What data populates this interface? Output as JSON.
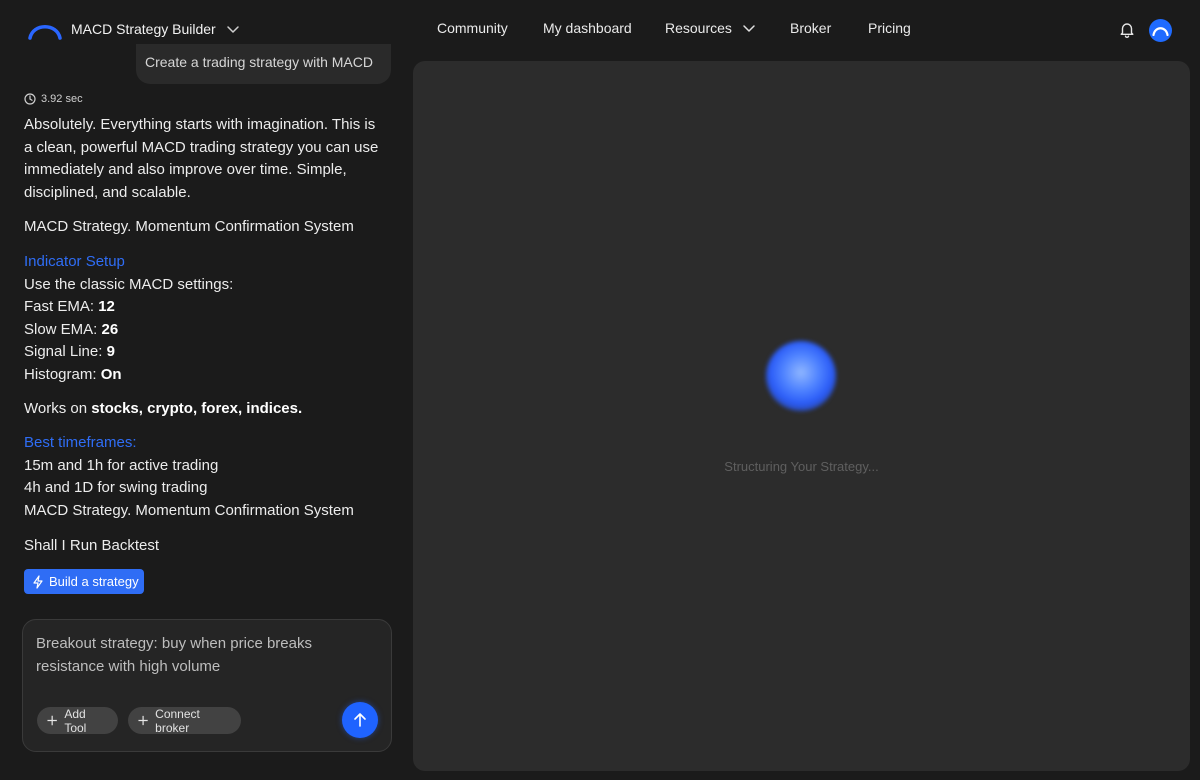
{
  "app": {
    "title": "MACD Strategy Builder"
  },
  "nav": {
    "items": [
      {
        "label": "Community"
      },
      {
        "label": "My dashboard"
      },
      {
        "label": "Resources"
      },
      {
        "label": "Broker"
      },
      {
        "label": "Pricing"
      }
    ]
  },
  "chat": {
    "user_message": "Create a trading strategy with MACD",
    "response_time": "3.92 sec",
    "intro": "Absolutely. Everything starts with imagination. This is a clean, powerful MACD trading strategy you can use immediately and also improve over time. Simple, disciplined, and scalable.",
    "strategy_name": "MACD Strategy. Momentum Confirmation System",
    "indicator_heading": "Indicator Setup",
    "indicator_intro": "Use the classic MACD settings:",
    "settings": [
      {
        "label": "Fast EMA: ",
        "value": "12"
      },
      {
        "label": "Slow EMA: ",
        "value": "26"
      },
      {
        "label": "Signal Line: ",
        "value": "9"
      },
      {
        "label": "Histogram: ",
        "value": "On"
      }
    ],
    "works_on_prefix": "Works on ",
    "works_on_markets": "stocks, crypto, forex, indices.",
    "timeframes_heading": "Best timeframes:",
    "timeframes": [
      "15m and 1h for active trading",
      "4h and 1D for swing trading",
      "MACD Strategy. Momentum Confirmation System"
    ],
    "question": "Shall I Run Backtest",
    "build_button": "Build a strategy"
  },
  "composer": {
    "value": "Breakout strategy: buy when price breaks resistance with high volume",
    "add_tool": "Add Tool",
    "connect_broker": "Connect broker"
  },
  "panel": {
    "status": "Structuring Your Strategy..."
  },
  "colors": {
    "accent": "#2f6df5",
    "send_button": "#1f63ff",
    "background": "#1b1b1b",
    "panel": "#2c2c2c"
  }
}
